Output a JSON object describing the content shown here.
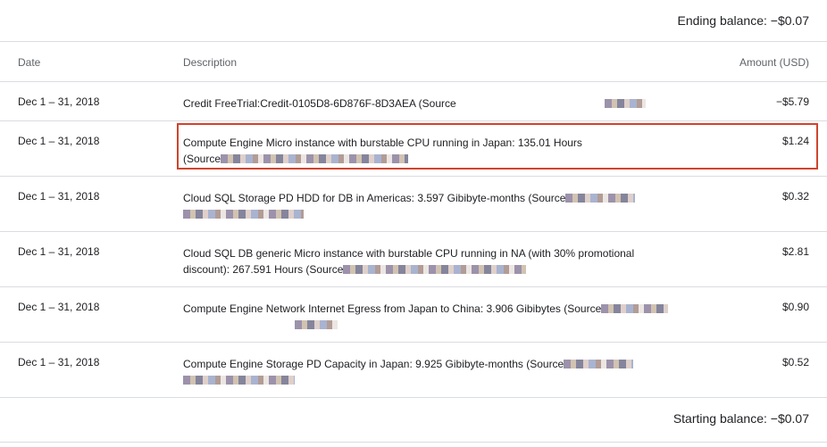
{
  "ending_balance": "Ending balance: −$0.07",
  "starting_balance": "Starting balance: −$0.07",
  "columns": {
    "date": "Date",
    "description": "Description",
    "amount": "Amount (USD)"
  },
  "rows": [
    {
      "date": "Dec 1 – 31, 2018",
      "desc": "Credit FreeTrial:Credit-0105D8-6D876F-8D3AEA (Source",
      "desc2": "",
      "amount": "−$5.79"
    },
    {
      "date": "Dec 1 – 31, 2018",
      "desc": "Compute Engine Micro instance with burstable CPU running in Japan: 135.01 Hours",
      "desc2": "(Source",
      "amount": "$1.24"
    },
    {
      "date": "Dec 1 – 31, 2018",
      "desc": "Cloud SQL Storage PD HDD for DB in Americas: 3.597 Gibibyte-months (Source",
      "desc2": "",
      "amount": "$0.32"
    },
    {
      "date": "Dec 1 – 31, 2018",
      "desc": "Cloud SQL DB generic Micro instance with burstable CPU running in NA (with 30% promotional",
      "desc2": "discount): 267.591 Hours (Source",
      "amount": "$2.81"
    },
    {
      "date": "Dec 1 – 31, 2018",
      "desc": "Compute Engine Network Internet Egress from Japan to China: 3.906 Gibibytes (Source",
      "desc2": "",
      "amount": "$0.90"
    },
    {
      "date": "Dec 1 – 31, 2018",
      "desc": "Compute Engine Storage PD Capacity in Japan: 9.925 Gibibyte-months (Source",
      "desc2": "",
      "amount": "$0.52"
    }
  ]
}
